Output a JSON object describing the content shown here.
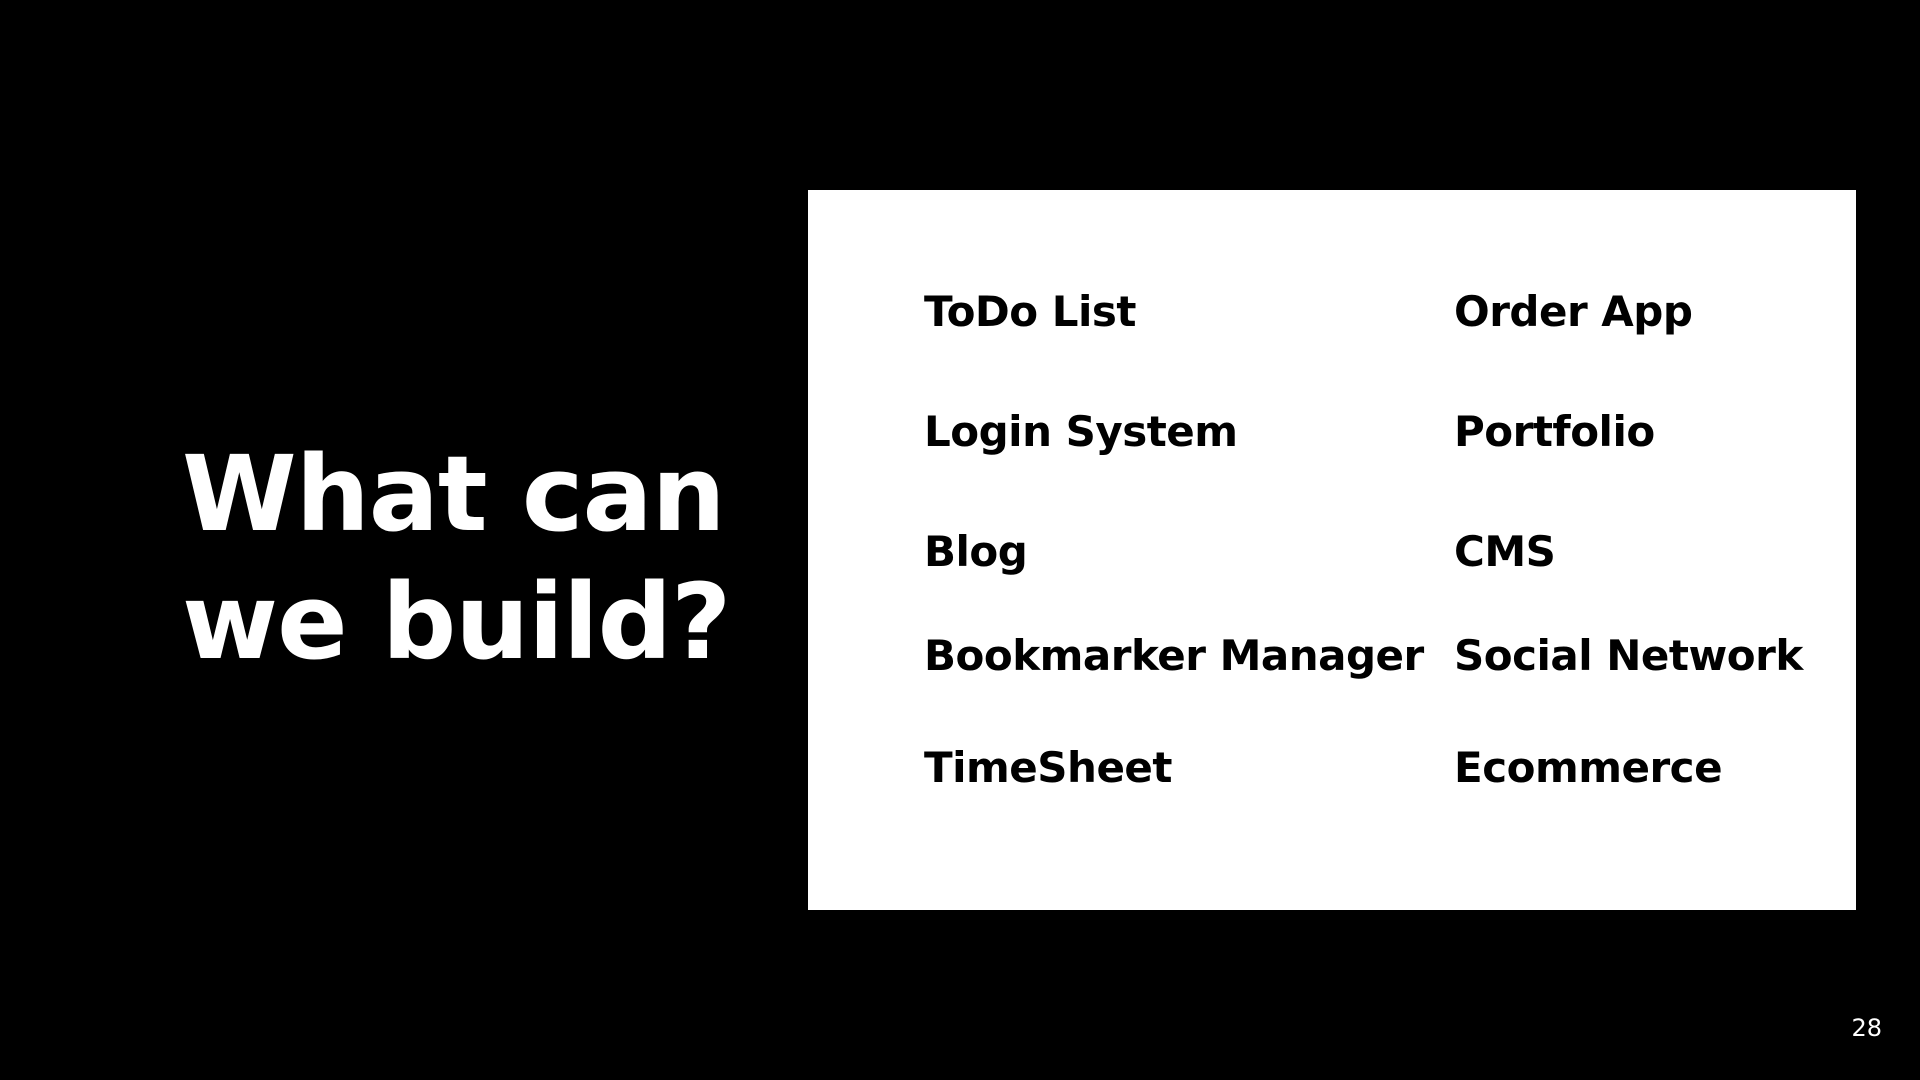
{
  "slide": {
    "title_line_1": "What can",
    "title_line_2": "we build?",
    "page_number": "28",
    "colors": {
      "background": "#000000",
      "title": "#ffffff",
      "box": "#ffffff",
      "item_text": "#000000"
    }
  },
  "projects": {
    "left": [
      "ToDo List",
      "Login System",
      "Blog",
      "Bookmarker Manager",
      "TimeSheet"
    ],
    "right": [
      "Order App",
      "Portfolio",
      "CMS",
      "Social Network",
      "Ecommerce"
    ]
  }
}
